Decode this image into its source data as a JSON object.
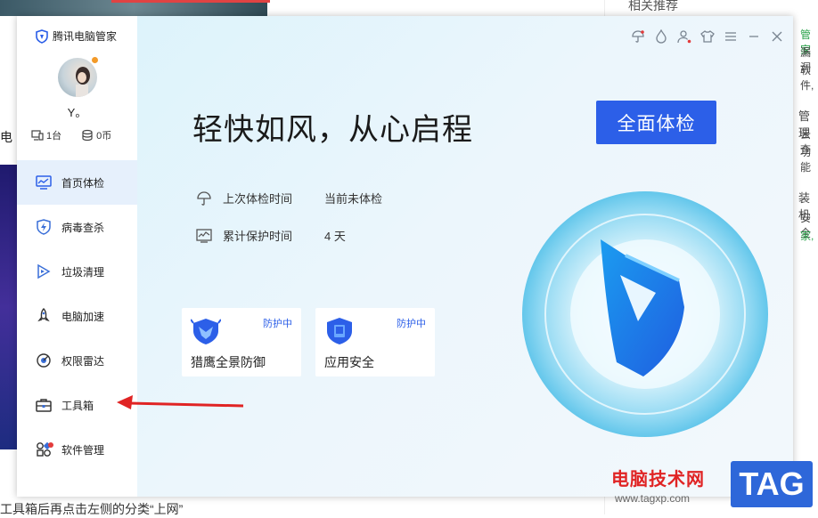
{
  "app": {
    "brand": "腾讯电脑管家",
    "user": {
      "name": "Y。",
      "devices": "1台",
      "coins": "0币"
    },
    "nav": [
      {
        "label": "首页体检",
        "icon": "monitor-icon",
        "active": true
      },
      {
        "label": "病毒查杀",
        "icon": "lightning-shield-icon",
        "active": false
      },
      {
        "label": "垃圾清理",
        "icon": "broom-icon",
        "active": false
      },
      {
        "label": "电脑加速",
        "icon": "rocket-icon",
        "active": false
      },
      {
        "label": "权限雷达",
        "icon": "radar-icon",
        "active": false
      },
      {
        "label": "工具箱",
        "icon": "toolbox-icon",
        "active": false
      },
      {
        "label": "软件管理",
        "icon": "apps-icon",
        "active": false
      }
    ],
    "topbar_icons": [
      "umbrella-icon",
      "drop-icon",
      "user-alert-icon",
      "skin-icon",
      "menu-icon",
      "minimize-icon",
      "close-icon"
    ]
  },
  "main": {
    "slogan": "轻快如风，从心启程",
    "scan_button": "全面体检",
    "info": {
      "last_check_label": "上次体检时间",
      "last_check_value": "当前未体检",
      "protect_label": "累计保护时间",
      "protect_value": "4 天"
    },
    "cards": [
      {
        "title": "猎鹰全景防御",
        "status": "防护中",
        "icon": "eagle-shield-icon"
      },
      {
        "title": "应用安全",
        "status": "防护中",
        "icon": "app-shield-icon"
      }
    ]
  },
  "background": {
    "left_text": "电",
    "bottom_text": "工具箱后再点击左侧的分类“上网”",
    "right_title": "相关推荐",
    "right_fragments": [
      "管家",
      "漏洞",
      "软件,",
      "管理",
      "云查",
      "功能",
      "装机",
      "安全",
      "家,"
    ]
  },
  "watermark": {
    "site": "电脑技术网",
    "url": "www.tagxp.com",
    "tag": "TAG"
  },
  "colors": {
    "accent": "#2c5fe8",
    "pointer": "#e02424",
    "status": "#2c5fe8"
  }
}
